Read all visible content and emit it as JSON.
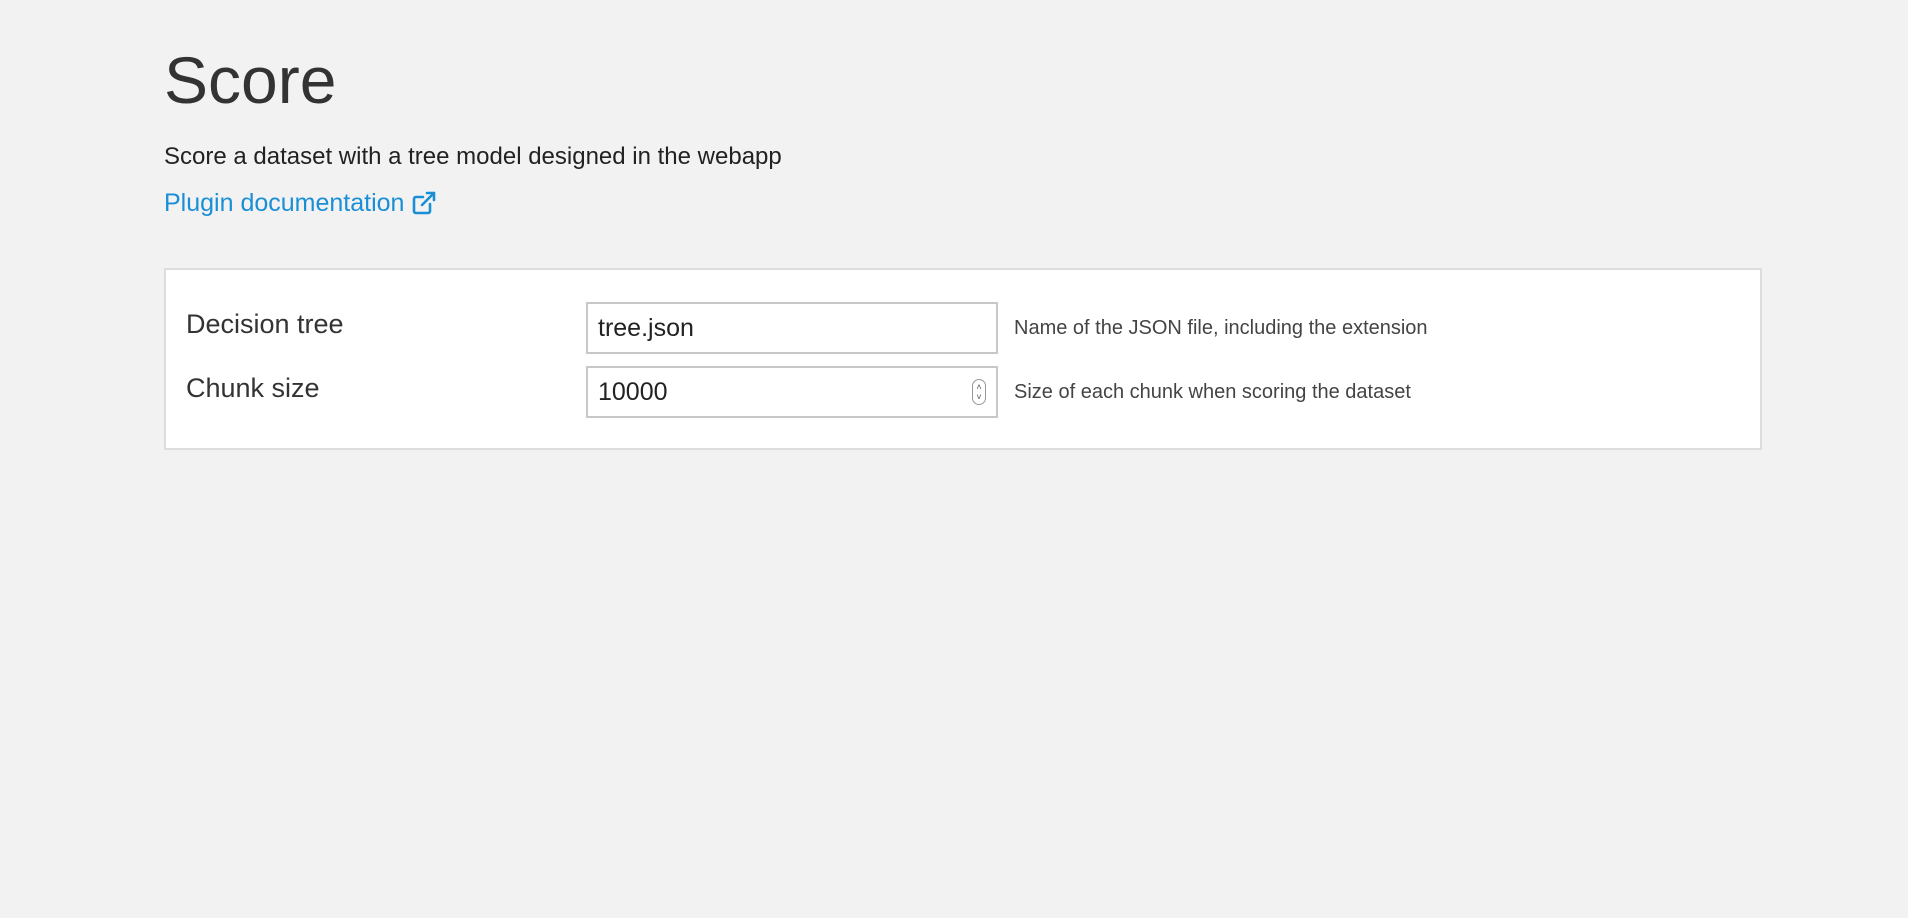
{
  "header": {
    "title": "Score",
    "description": "Score a dataset with a tree model designed in the webapp",
    "doc_link_label": "Plugin documentation",
    "doc_link_icon": "external-link-icon",
    "link_color": "#1a8fd6"
  },
  "form": {
    "fields": [
      {
        "label": "Decision tree",
        "value": "tree.json",
        "help": "Name of the JSON file, including the extension"
      },
      {
        "label": "Chunk size",
        "value": "10000",
        "help": "Size of each chunk when scoring the dataset",
        "spinner_icon": "number-spinner-icon"
      }
    ]
  }
}
